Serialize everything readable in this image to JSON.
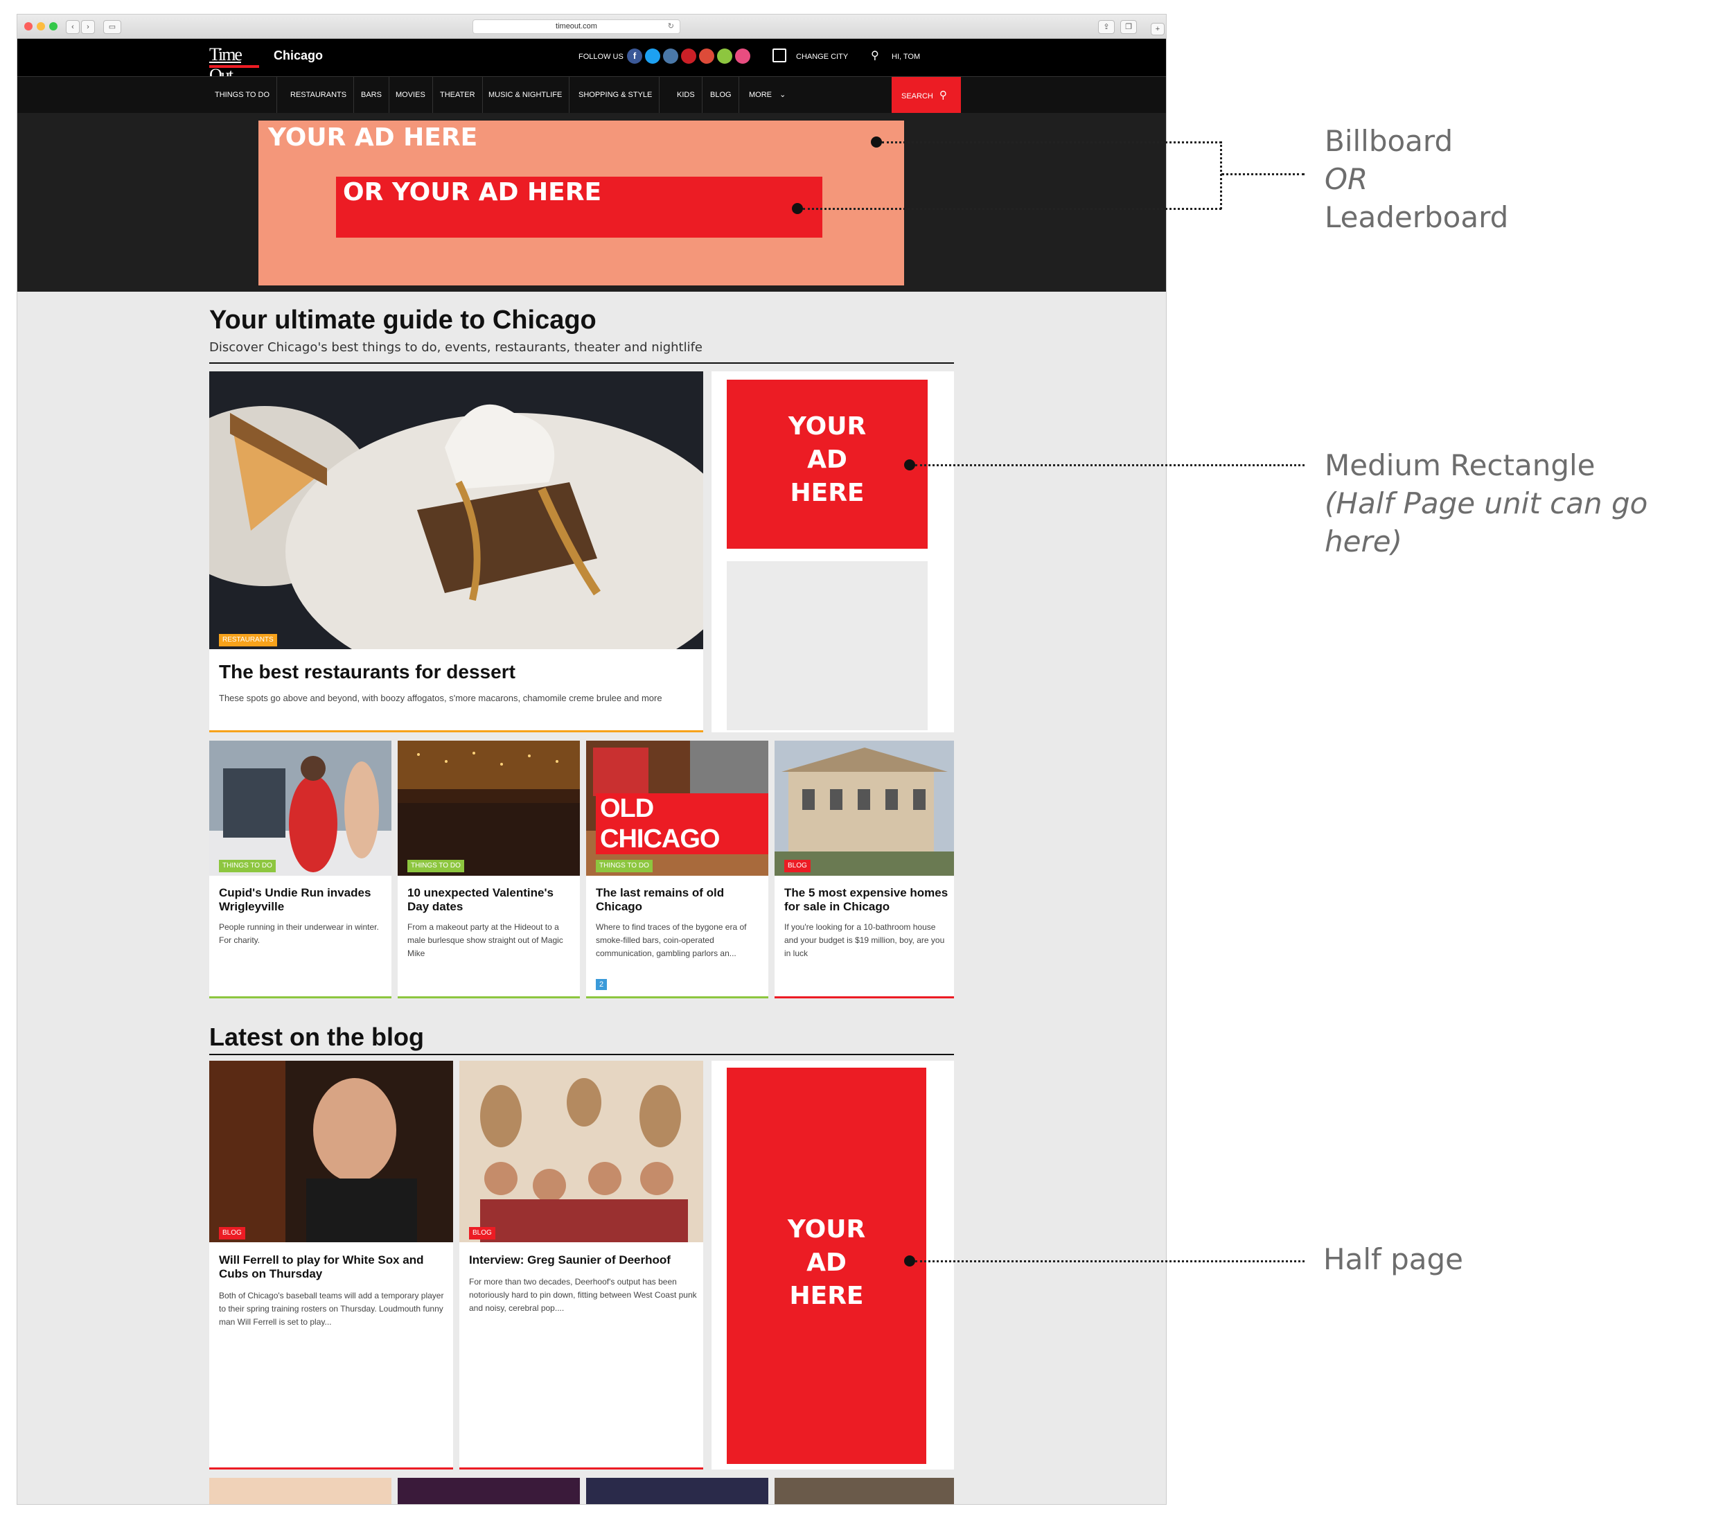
{
  "browser": {
    "url": "timeout.com"
  },
  "header": {
    "logo": "Time Out",
    "city": "Chicago",
    "follow_label": "FOLLOW US",
    "change_city": "CHANGE CITY",
    "user_greeting": "HI, TOM",
    "social_icons": [
      "facebook-icon",
      "twitter-icon",
      "instagram-icon",
      "pinterest-icon",
      "googleplus-icon",
      "spotify-icon",
      "foursquare-icon"
    ]
  },
  "nav": {
    "items": [
      "THINGS TO DO",
      "RESTAURANTS",
      "BARS",
      "MOVIES",
      "THEATER",
      "MUSIC & NIGHTLIFE",
      "SHOPPING & STYLE",
      "KIDS",
      "BLOG",
      "MORE"
    ],
    "search_label": "SEARCH"
  },
  "ads": {
    "billboard": "YOUR AD HERE",
    "leaderboard": "OR YOUR AD HERE",
    "medium_rect": [
      "YOUR",
      "AD",
      "HERE"
    ],
    "half_page": [
      "YOUR",
      "AD",
      "HERE"
    ]
  },
  "guide": {
    "title": "Your ultimate guide to Chicago",
    "subtitle": "Discover Chicago's best things to do, events, restaurants, theater and nightlife"
  },
  "feature": {
    "tag": "RESTAURANTS",
    "title": "The best restaurants for dessert",
    "desc": "These spots go above and beyond, with boozy affogatos, s'more macarons, chamomile creme brulee and more"
  },
  "cards": [
    {
      "tag": "THINGS TO DO",
      "title": "Cupid's Undie Run invades Wrigleyville",
      "desc": "People running in their underwear in winter. For charity."
    },
    {
      "tag": "THINGS TO DO",
      "title": "10 unexpected Valentine's Day dates",
      "desc": "From a makeout party at the Hideout to a male burlesque show straight out of Magic Mike"
    },
    {
      "tag": "THINGS TO DO",
      "title": "The last remains of old Chicago",
      "desc": "Where to find traces of the bygone era of smoke-filled bars, coin-operated communication, gambling parlors an...",
      "overlay": "OLD CHICAGO",
      "badge": "2"
    },
    {
      "tag": "BLOG",
      "title": "The 5 most expensive homes for sale in Chicago",
      "desc": "If you're looking for a 10-bathroom house and your budget is $19 million, boy, are you in luck"
    }
  ],
  "blog": {
    "title": "Latest on the blog",
    "posts": [
      {
        "tag": "BLOG",
        "title": "Will Ferrell to play for White Sox and Cubs on Thursday",
        "desc": "Both of Chicago's baseball teams will add a temporary player to their spring training rosters on Thursday. Loudmouth funny man Will Ferrell is set to play..."
      },
      {
        "tag": "BLOG",
        "title": "Interview: Greg Saunier of Deerhoof",
        "desc": "For more than two decades, Deerhoof's output has been notoriously hard to pin down, fitting between West Coast punk and noisy, cerebral pop...."
      }
    ]
  },
  "callouts": {
    "billboard": [
      "Billboard",
      "OR",
      "Leaderboard"
    ],
    "medium": [
      "Medium Rectangle",
      "(Half Page unit can go here)"
    ],
    "halfpage": "Half page"
  },
  "colors": {
    "accent_red": "#ec1c24",
    "billboard_salmon": "#f4977a",
    "things_to_do_green": "#8dc63f",
    "restaurants_orange": "#f7a21b"
  }
}
